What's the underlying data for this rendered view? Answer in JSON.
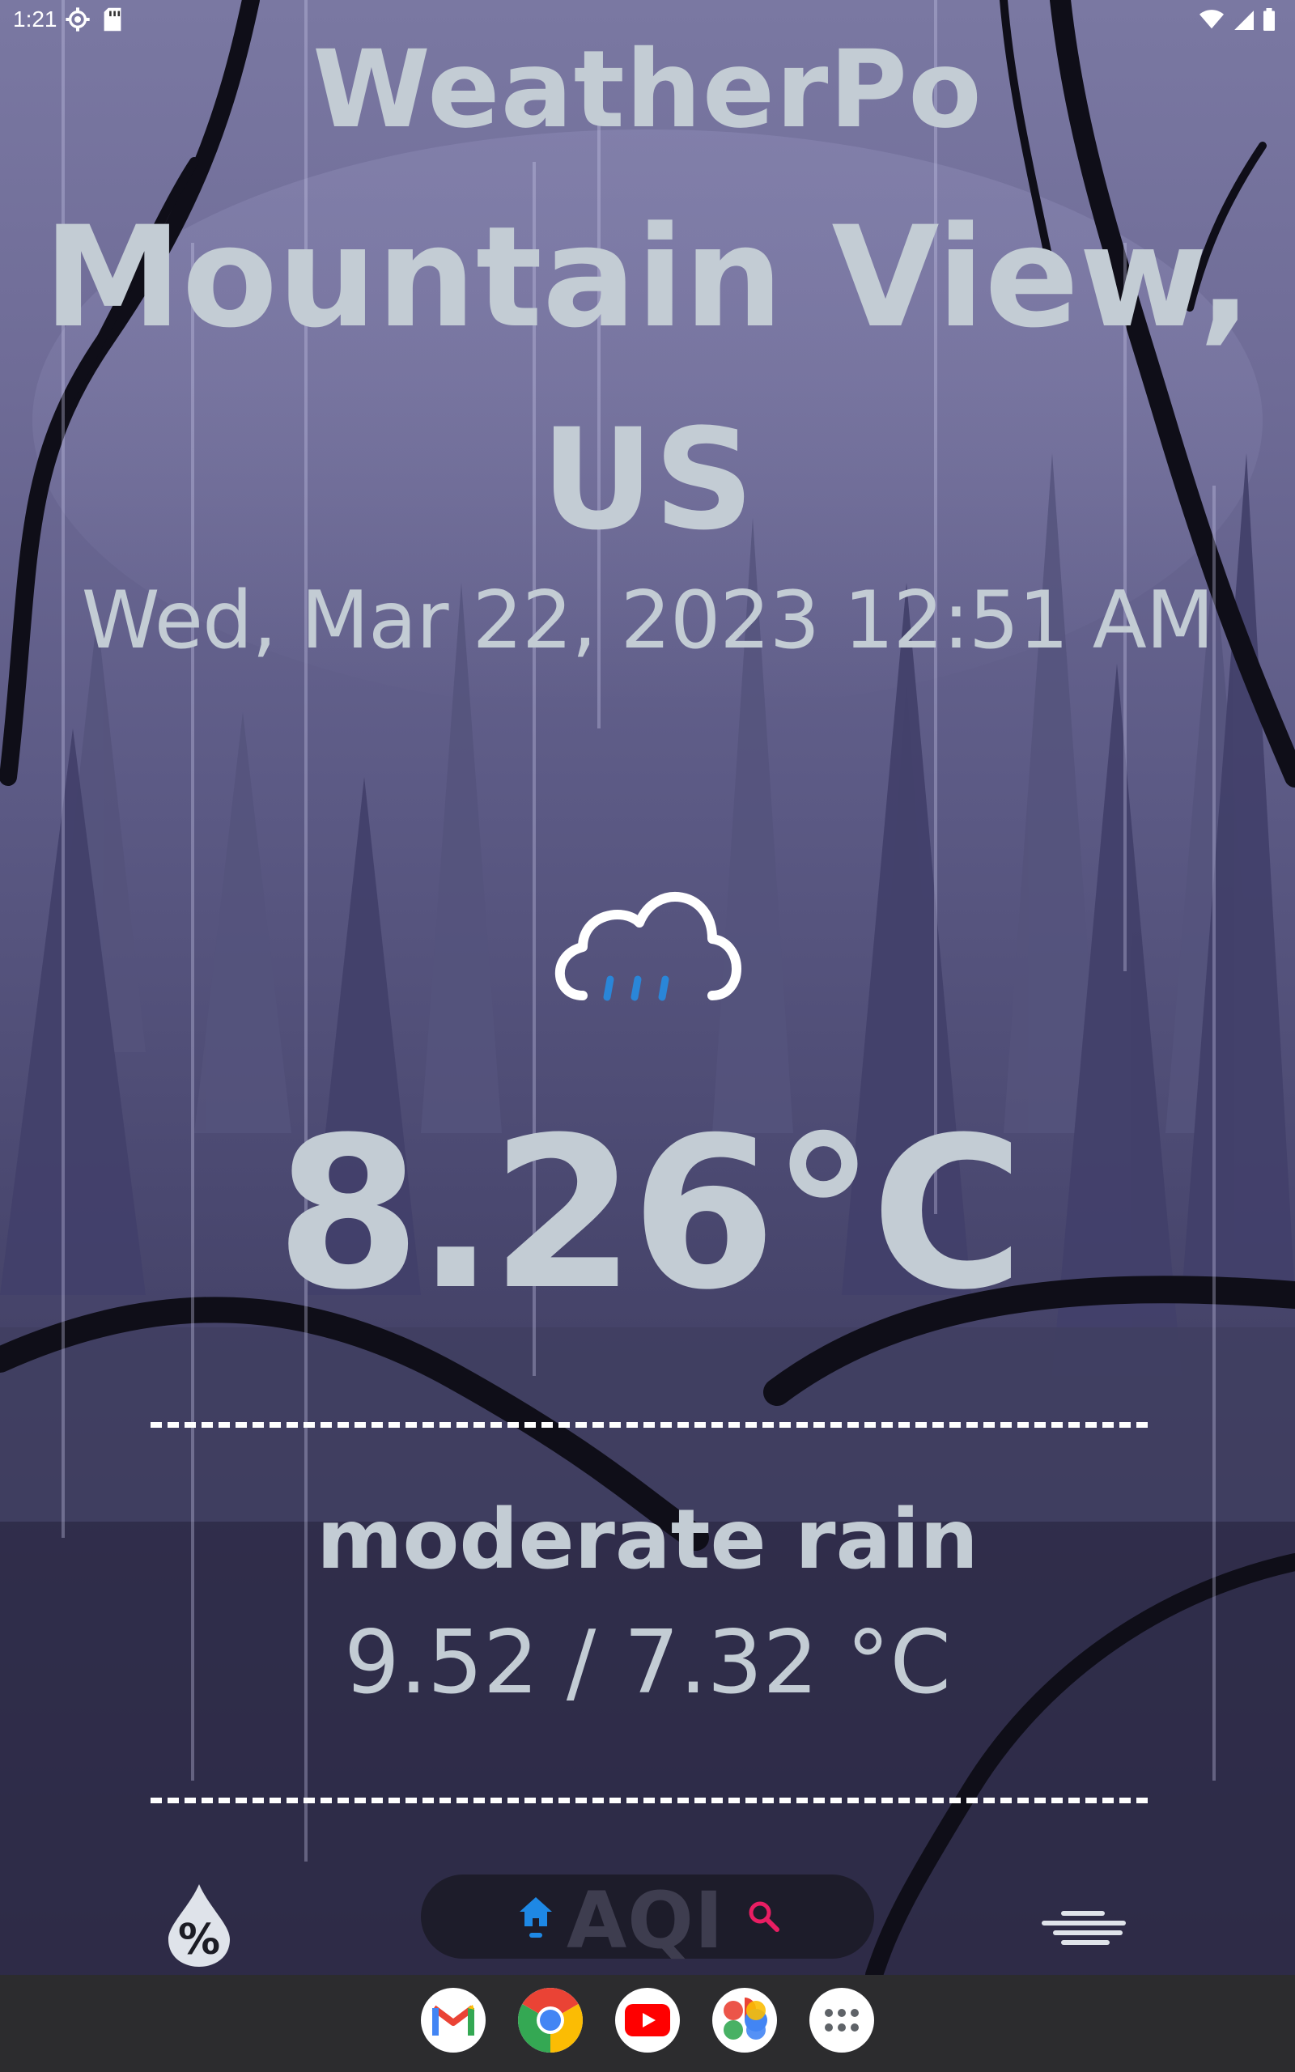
{
  "status_bar": {
    "time": "1:21",
    "icons_left": [
      "settings-icon",
      "sd-card-icon"
    ],
    "icons_right": [
      "wifi-icon",
      "signal-icon",
      "battery-icon"
    ]
  },
  "app": {
    "title": "WeatherPo"
  },
  "location": {
    "city": "Mountain View,",
    "country": "US"
  },
  "datetime": "Wed, Mar 22, 2023 12:51 AM",
  "current": {
    "icon": "rain-cloud-icon",
    "temperature": "8.26°C",
    "description": "moderate rain",
    "min_max": "9.52 / 7.32 °C"
  },
  "bottom_nav": {
    "left_icon": "humidity-icon",
    "home_icon": "home-icon",
    "center_label": "AQI",
    "search_icon": "search-icon",
    "right_icon": "fog-icon"
  },
  "dock": {
    "apps": [
      "Gmail",
      "Chrome",
      "YouTube",
      "Photos",
      "App drawer"
    ]
  },
  "colors": {
    "text": "#c3ccd4",
    "rain_accent": "#2a86d8",
    "nav_home_accent": "#1e88e5",
    "nav_search_accent": "#e91e63"
  }
}
